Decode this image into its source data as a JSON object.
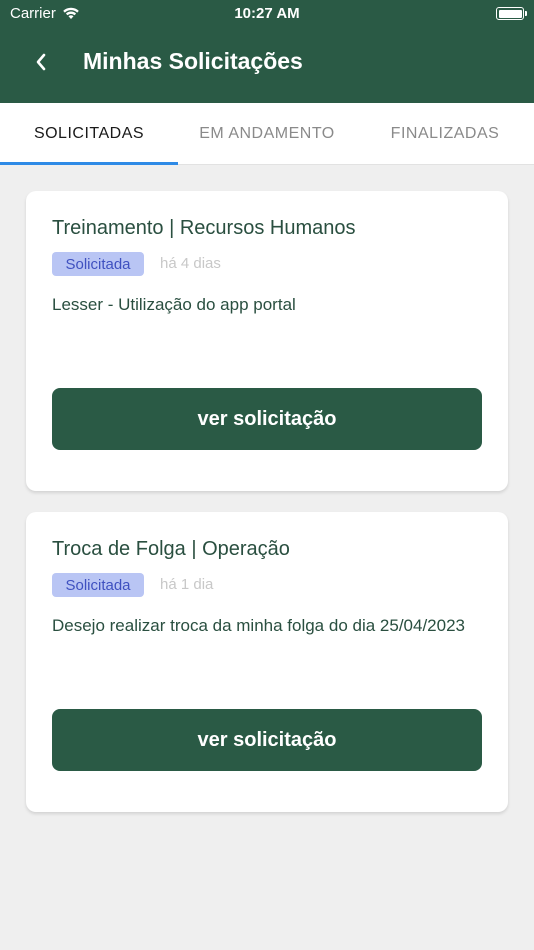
{
  "status_bar": {
    "carrier": "Carrier",
    "time": "10:27 AM"
  },
  "header": {
    "title": "Minhas Solicitações",
    "back_icon": "chevron-left-icon",
    "background_color": "#2a5a45"
  },
  "tabs": [
    {
      "label": "SOLICITADAS",
      "active": true
    },
    {
      "label": "EM ANDAMENTO",
      "active": false
    },
    {
      "label": "FINALIZADAS",
      "active": false
    }
  ],
  "requests": [
    {
      "title": "Treinamento | Recursos Humanos",
      "status": "Solicitada",
      "time_ago": "há 4 dias",
      "description": "Lesser - Utilização do app portal",
      "button_label": "ver solicitação"
    },
    {
      "title": "Troca de Folga | Operação",
      "status": "Solicitada",
      "time_ago": "há 1 dia",
      "description": "Desejo realizar troca da minha folga do dia 25/04/2023",
      "button_label": "ver solicitação"
    }
  ],
  "colors": {
    "accent": "#2e8ae6",
    "primary": "#2a5a45",
    "badge_bg": "#b9c5f4",
    "badge_text": "#3f51c0"
  }
}
